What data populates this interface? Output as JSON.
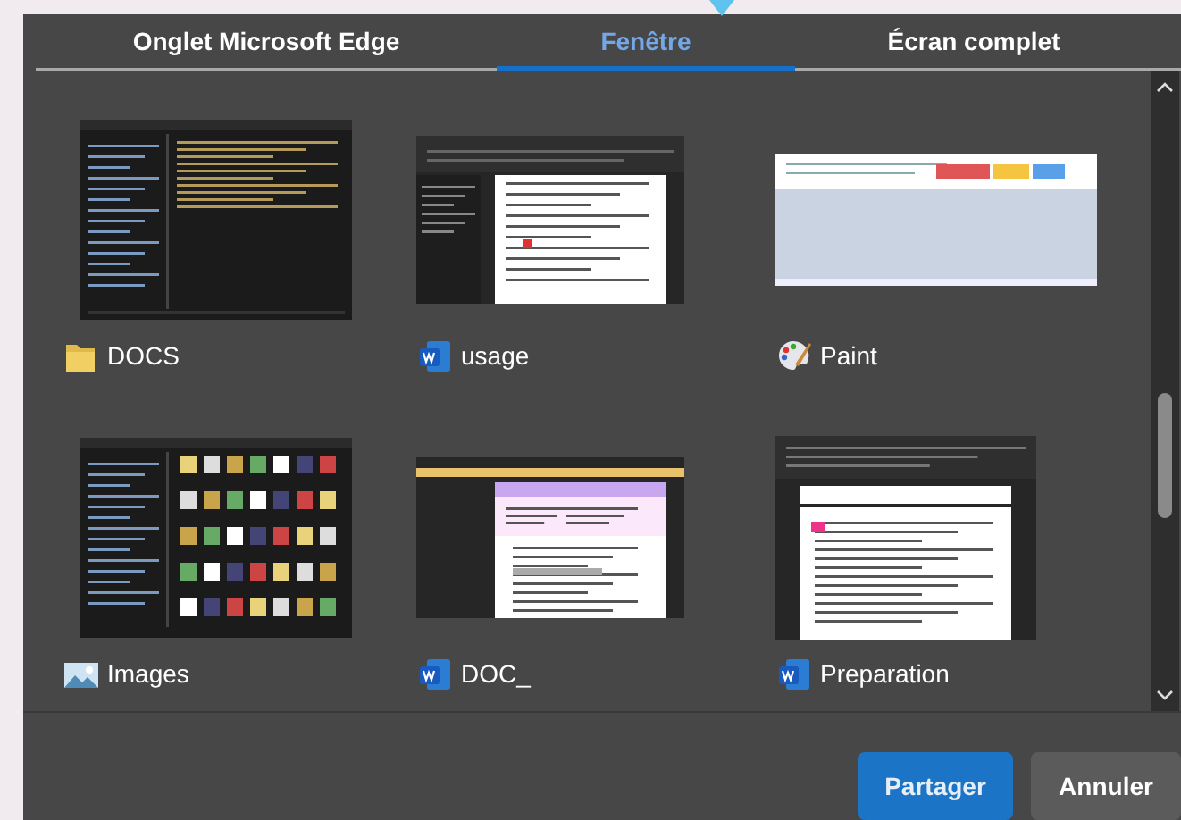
{
  "tabs": [
    {
      "label": "Onglet Microsoft Edge",
      "selected": false
    },
    {
      "label": "Fenêtre",
      "selected": true
    },
    {
      "label": "Écran complet",
      "selected": false
    }
  ],
  "windows": [
    {
      "title": "DOCS",
      "kind": "folder"
    },
    {
      "title": "usage",
      "kind": "document"
    },
    {
      "title": "Paint",
      "kind": "palette"
    },
    {
      "title": "Images",
      "kind": "images"
    },
    {
      "title": "DOC_",
      "kind": "document"
    },
    {
      "title": "Preparation",
      "kind": "document"
    }
  ],
  "buttons": [
    {
      "label": "Partager",
      "kind": "primary"
    },
    {
      "label": "Annuler",
      "kind": "secondary"
    }
  ]
}
